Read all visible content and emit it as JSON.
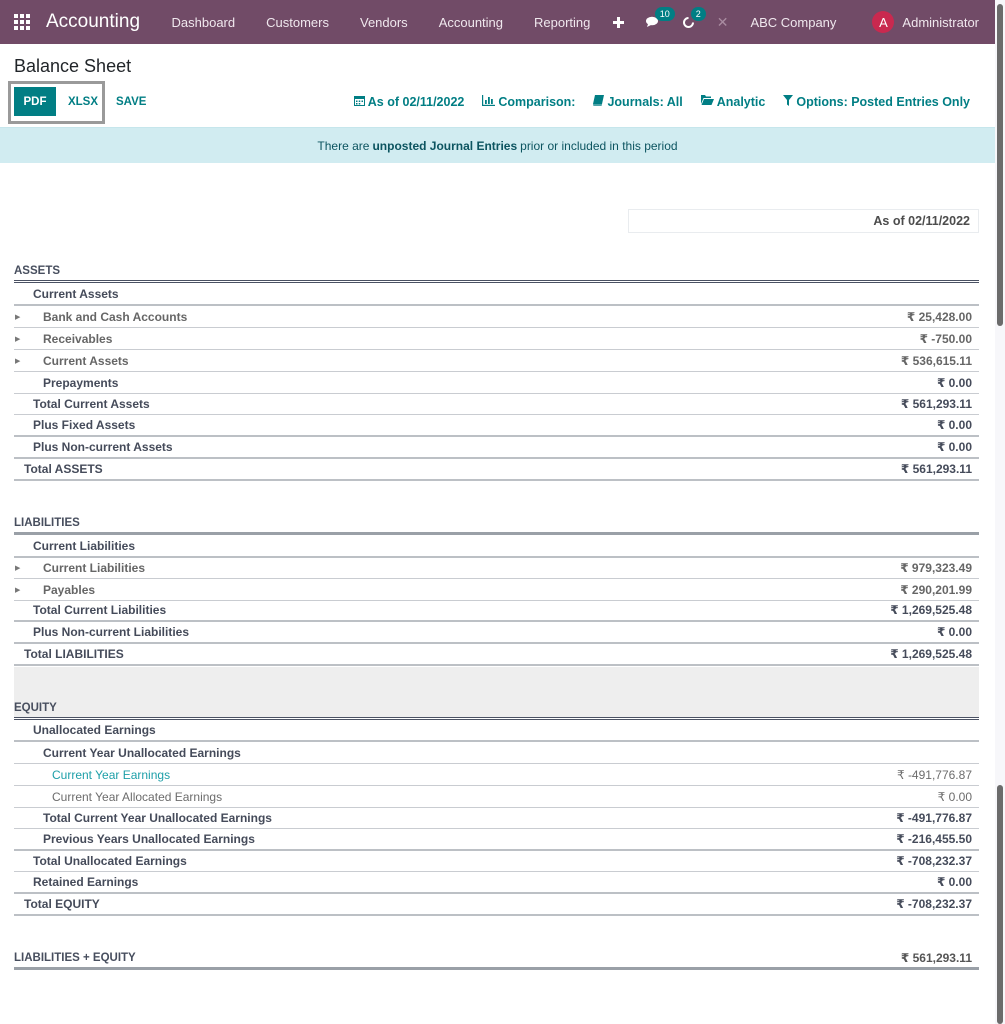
{
  "navbar": {
    "app_name": "Accounting",
    "menu": [
      "Dashboard",
      "Customers",
      "Vendors",
      "Accounting",
      "Reporting"
    ],
    "messages_count": "10",
    "activities_count": "2",
    "company": "ABC Company",
    "avatar_letter": "A",
    "user": "Administrator",
    "brand_color": "#714b67"
  },
  "page": {
    "title": "Balance Sheet",
    "buttons": {
      "pdf": "PDF",
      "xlsx": "XLSX",
      "save": "SAVE"
    },
    "filters": [
      {
        "icon": "calendar-icon",
        "label": "As of 02/11/2022"
      },
      {
        "icon": "bar-chart-icon",
        "label": "Comparison:"
      },
      {
        "icon": "book-icon",
        "label": "Journals: All"
      },
      {
        "icon": "folder-open-icon",
        "label": "Analytic"
      },
      {
        "icon": "filter-icon",
        "label": "Options: Posted Entries Only"
      }
    ],
    "alert": {
      "prefix": "There are",
      "bold": "unposted Journal Entries",
      "suffix": "prior or included in this period"
    },
    "accent_color": "#017e84"
  },
  "report": {
    "column_header": "As of 02/11/2022",
    "assets": {
      "title": "ASSETS",
      "rows": [
        {
          "label": "Current Assets",
          "amount": ""
        },
        {
          "label": "Bank and Cash Accounts",
          "amount": "₹ 25,428.00"
        },
        {
          "label": "Receivables",
          "amount": "₹ -750.00"
        },
        {
          "label": "Current Assets",
          "amount": "₹ 536,615.11"
        },
        {
          "label": "Prepayments",
          "amount": "₹ 0.00"
        },
        {
          "label": "Total Current Assets",
          "amount": "₹ 561,293.11"
        },
        {
          "label": "Plus Fixed Assets",
          "amount": "₹ 0.00"
        },
        {
          "label": "Plus Non-current Assets",
          "amount": "₹ 0.00"
        },
        {
          "label": "Total ASSETS",
          "amount": "₹ 561,293.11"
        }
      ]
    },
    "liabilities": {
      "title": "LIABILITIES",
      "rows": [
        {
          "label": "Current Liabilities",
          "amount": ""
        },
        {
          "label": "Current Liabilities",
          "amount": "₹ 979,323.49"
        },
        {
          "label": "Payables",
          "amount": "₹ 290,201.99"
        },
        {
          "label": "Total Current Liabilities",
          "amount": "₹ 1,269,525.48"
        },
        {
          "label": "Plus Non-current Liabilities",
          "amount": "₹ 0.00"
        },
        {
          "label": "Total LIABILITIES",
          "amount": "₹ 1,269,525.48"
        }
      ]
    },
    "equity": {
      "title": "EQUITY",
      "rows": [
        {
          "label": "Unallocated Earnings",
          "amount": ""
        },
        {
          "label": "Current Year Unallocated Earnings",
          "amount": ""
        },
        {
          "label": "Current Year Earnings",
          "amount": "₹ -491,776.87"
        },
        {
          "label": "Current Year Allocated Earnings",
          "amount": "₹ 0.00"
        },
        {
          "label": "Total Current Year Unallocated Earnings",
          "amount": "₹ -491,776.87"
        },
        {
          "label": "Previous Years Unallocated Earnings",
          "amount": "₹ -216,455.50"
        },
        {
          "label": "Total Unallocated Earnings",
          "amount": "₹ -708,232.37"
        },
        {
          "label": "Retained Earnings",
          "amount": "₹ 0.00"
        },
        {
          "label": "Total EQUITY",
          "amount": "₹ -708,232.37"
        }
      ]
    },
    "grand_total": {
      "label": "LIABILITIES + EQUITY",
      "amount": "₹ 561,293.11"
    }
  }
}
